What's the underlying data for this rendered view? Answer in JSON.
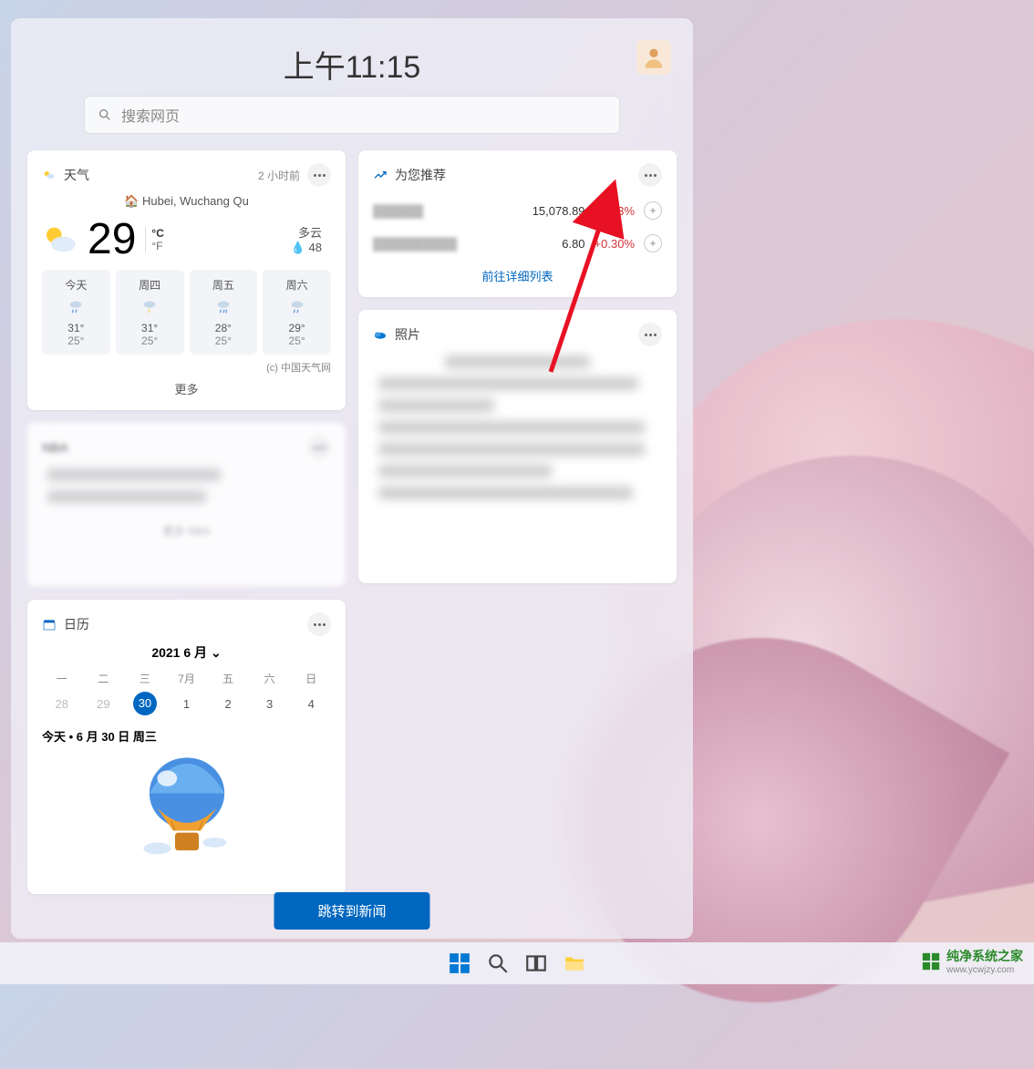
{
  "header": {
    "time": "上午11:15"
  },
  "search": {
    "placeholder": "搜索网页"
  },
  "weather": {
    "title": "天气",
    "updated": "2 小时前",
    "location": "Hubei, Wuchang Qu",
    "temp": "29",
    "unit_c": "°C",
    "unit_f": "°F",
    "condition": "多云",
    "humidity": "48",
    "days": [
      {
        "label": "今天",
        "hi": "31°",
        "lo": "25°"
      },
      {
        "label": "周四",
        "hi": "31°",
        "lo": "25°"
      },
      {
        "label": "周五",
        "hi": "28°",
        "lo": "25°"
      },
      {
        "label": "周六",
        "hi": "29°",
        "lo": "25°"
      }
    ],
    "attribution": "(c) 中国天气网",
    "more": "更多"
  },
  "sports": {
    "title": "NBA",
    "more": "更多 NBA"
  },
  "calendar": {
    "title": "日历",
    "month_label": "2021 6 月",
    "dow": [
      "一",
      "二",
      "三",
      "7月",
      "五",
      "六",
      "日"
    ],
    "row": [
      "28",
      "29",
      "30",
      "1",
      "2",
      "3",
      "4"
    ],
    "today_index": 2,
    "today_line": "今天 • 6 月 30 日 周三"
  },
  "stocks": {
    "title": "为您推荐",
    "rows": [
      {
        "price": "15,078.89",
        "change": "+0.53%"
      },
      {
        "price": "6.80",
        "change": "+0.30%"
      }
    ],
    "link": "前往详细列表"
  },
  "photos": {
    "title": "照片"
  },
  "news_button": "跳转到新闻",
  "watermark": {
    "text": "纯净系统之家",
    "url": "www.ycwjzy.com"
  }
}
